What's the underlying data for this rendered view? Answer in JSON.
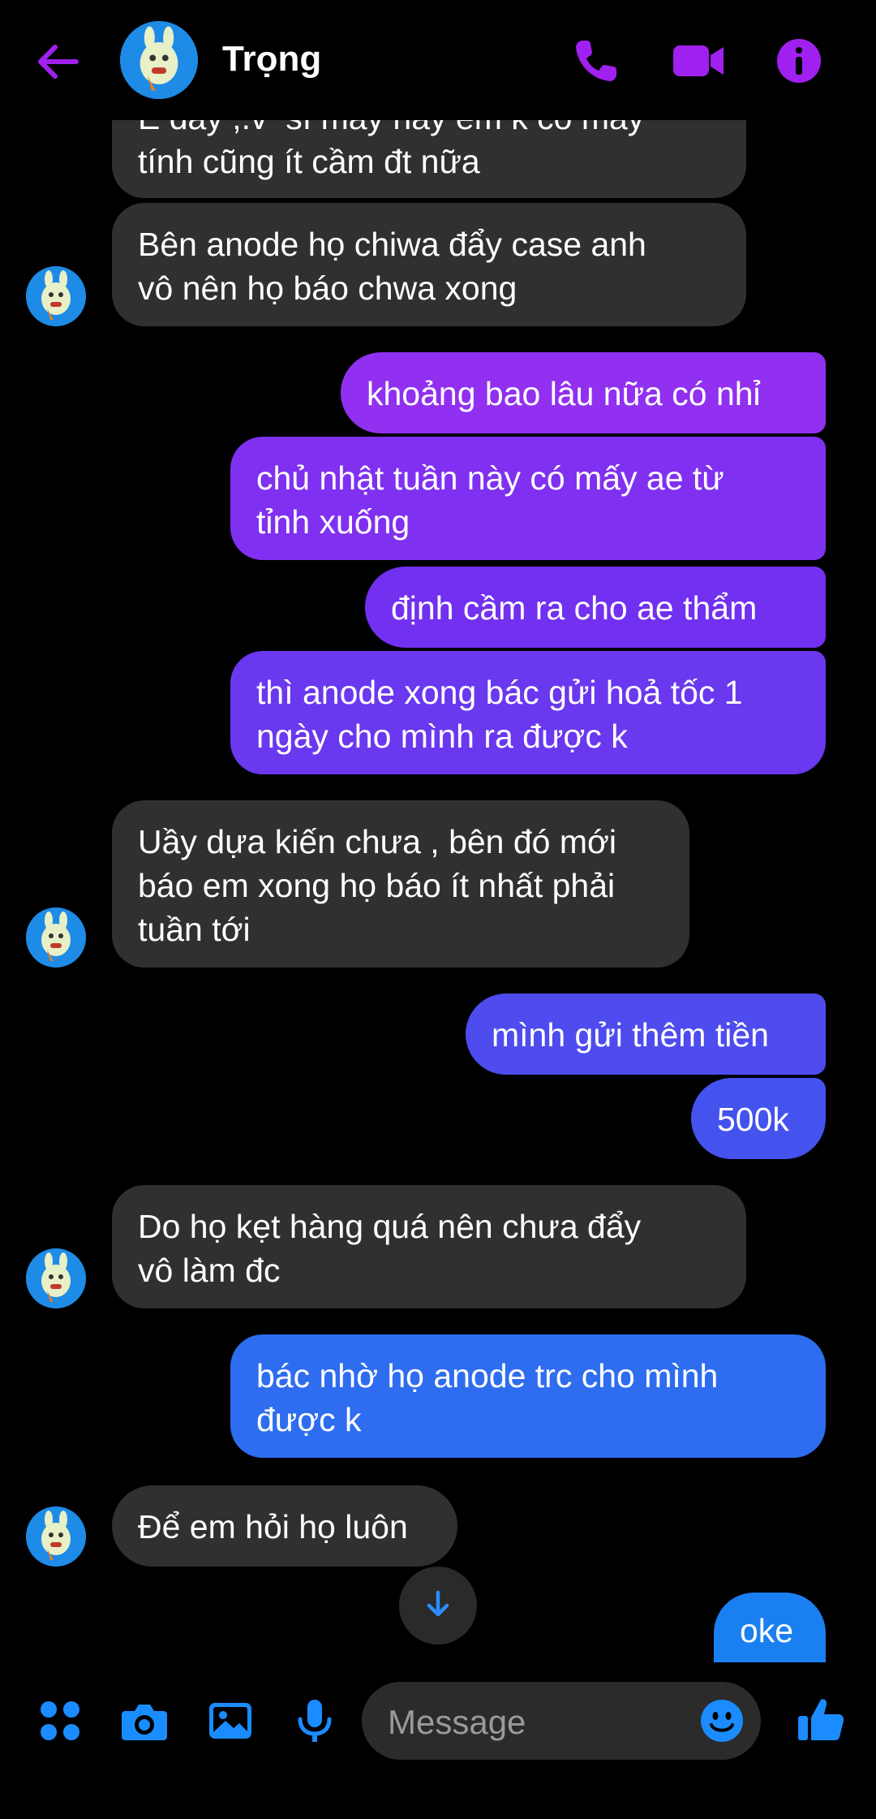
{
  "header": {
    "title": "Trọng",
    "back_icon": "arrow-left-icon",
    "call_icon": "phone-icon",
    "video_icon": "video-camera-icon",
    "info_icon": "info-icon",
    "accent": "#a020f0"
  },
  "messages": [
    {
      "side": "in",
      "text": "E đây ;.v  sĩ máy này em k có máy\ntính cũng ít cầm đt nữa"
    },
    {
      "side": "in",
      "text": "Bên anode họ chiwa đẩy case anh\nvô nên họ báo chwa xong"
    },
    {
      "side": "out",
      "text": "khoảng bao lâu nữa có nhỉ"
    },
    {
      "side": "out",
      "text": "chủ nhật tuần này có mấy ae từ\ntỉnh xuống"
    },
    {
      "side": "out",
      "text": "định cầm ra cho ae thẩm"
    },
    {
      "side": "out",
      "text": "thì anode xong bác gửi hoả tốc 1\nngày cho mình ra được k"
    },
    {
      "side": "in",
      "text": "Uầy dựa kiến chưa , bên đó mới\nbáo em xong họ báo ít nhất phải\ntuần tới"
    },
    {
      "side": "out",
      "text": "mình gửi thêm tiền"
    },
    {
      "side": "out",
      "text": "500k"
    },
    {
      "side": "in",
      "text": "Do họ kẹt hàng quá nên chưa đẩy\nvô làm đc"
    },
    {
      "side": "out",
      "text": "bác nhờ họ anode trc cho mình\nđược k"
    },
    {
      "side": "in",
      "text": "Để em hỏi họ luôn"
    },
    {
      "side": "out",
      "text": "oke"
    }
  ],
  "composer": {
    "placeholder": "Message",
    "icons": [
      "apps-icon",
      "camera-icon",
      "image-icon",
      "microphone-icon",
      "emoji-icon",
      "thumbs-up-icon"
    ],
    "accent": "#1a8cff"
  },
  "scroll_down_icon": "arrow-down-icon"
}
